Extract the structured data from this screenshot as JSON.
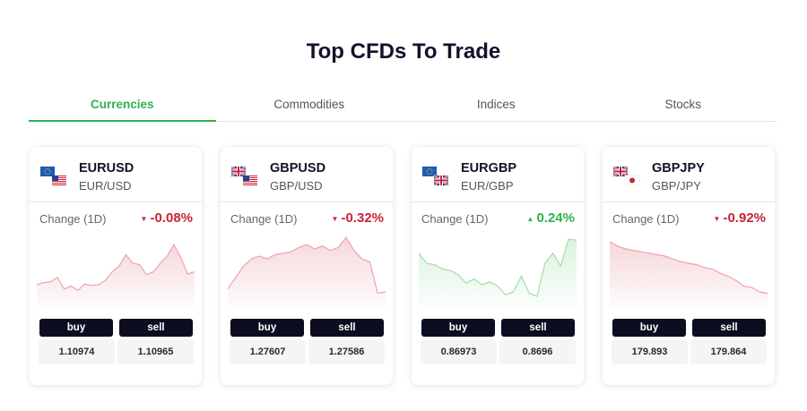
{
  "page": {
    "title": "Top CFDs To Trade"
  },
  "tabs": [
    {
      "label": "Currencies",
      "active": true
    },
    {
      "label": "Commodities",
      "active": false
    },
    {
      "label": "Indices",
      "active": false
    },
    {
      "label": "Stocks",
      "active": false
    }
  ],
  "colors": {
    "up": "#2fb24f",
    "down": "#c8243a",
    "button": "#0d0d21"
  },
  "cards": [
    {
      "symbol": "EURUSD",
      "pair": "EUR/USD",
      "flags": [
        "eu-flag",
        "us-flag"
      ],
      "change_label": "Change (1D)",
      "change": "-0.08%",
      "direction": "down",
      "buy_label": "buy",
      "sell_label": "sell",
      "buy_price": "1.10974",
      "sell_price": "1.10965",
      "chart_data": {
        "type": "area",
        "values": [
          30,
          33,
          34,
          40,
          24,
          28,
          22,
          31,
          29,
          30,
          36,
          48,
          56,
          72,
          60,
          58,
          44,
          48,
          60,
          70,
          86,
          68,
          45,
          48
        ]
      }
    },
    {
      "symbol": "GBPUSD",
      "pair": "GBP/USD",
      "flags": [
        "uk-flag",
        "us-flag"
      ],
      "change_label": "Change (1D)",
      "change": "-0.32%",
      "direction": "down",
      "buy_label": "buy",
      "sell_label": "sell",
      "buy_price": "1.27607",
      "sell_price": "1.27586",
      "chart_data": {
        "type": "area",
        "values": [
          24,
          40,
          56,
          66,
          70,
          66,
          72,
          74,
          76,
          82,
          86,
          80,
          84,
          78,
          82,
          96,
          78,
          66,
          62,
          18,
          20
        ]
      }
    },
    {
      "symbol": "EURGBP",
      "pair": "EUR/GBP",
      "flags": [
        "eu-flag",
        "uk-flag"
      ],
      "change_label": "Change (1D)",
      "change": "0.24%",
      "direction": "up",
      "buy_label": "buy",
      "sell_label": "sell",
      "buy_price": "0.86973",
      "sell_price": "0.8696",
      "chart_data": {
        "type": "area",
        "values": [
          74,
          60,
          58,
          52,
          50,
          44,
          32,
          38,
          30,
          34,
          28,
          16,
          20,
          42,
          18,
          14,
          60,
          74,
          56,
          94,
          92
        ]
      }
    },
    {
      "symbol": "GBPJPY",
      "pair": "GBP/JPY",
      "flags": [
        "uk-flag",
        "jp-flag"
      ],
      "change_label": "Change (1D)",
      "change": "-0.92%",
      "direction": "down",
      "buy_label": "buy",
      "sell_label": "sell",
      "buy_price": "179.893",
      "sell_price": "179.864",
      "chart_data": {
        "type": "area",
        "values": [
          90,
          84,
          80,
          78,
          76,
          74,
          72,
          70,
          66,
          62,
          60,
          58,
          54,
          52,
          46,
          42,
          36,
          28,
          26,
          20,
          18
        ]
      }
    }
  ]
}
